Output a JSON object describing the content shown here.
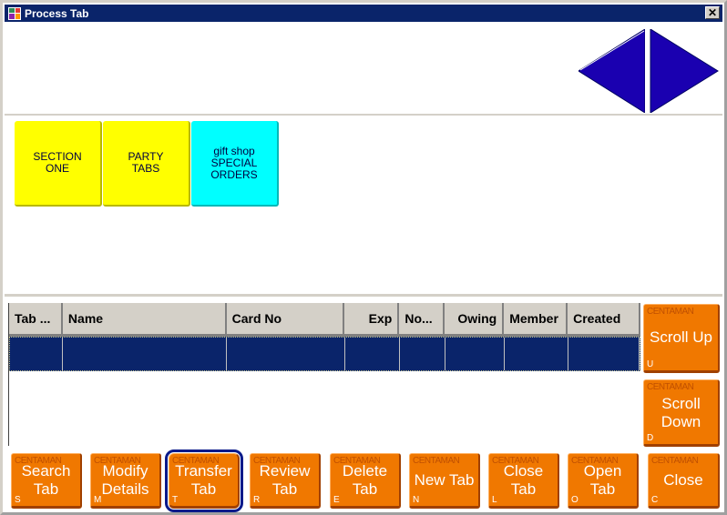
{
  "window": {
    "title": "Process Tab",
    "close_label": "✕"
  },
  "navigation": {
    "prev_icon": "triangle-left-icon",
    "next_icon": "triangle-right-icon",
    "arrow_color": "#1a00b0"
  },
  "sections": [
    {
      "label": "SECTION\nONE",
      "color": "#ffff00"
    },
    {
      "label": "PARTY\nTABS",
      "color": "#ffff00"
    },
    {
      "label": "gift shop\nSPECIAL\nORDERS",
      "color": "#00ffff"
    }
  ],
  "grid": {
    "columns": [
      "Tab ...",
      "Name",
      "Card No",
      "Exp",
      "No...",
      "Owing",
      "Member",
      "Created"
    ],
    "rows": [
      [
        "",
        "",
        "",
        "",
        "",
        "",
        "",
        ""
      ]
    ],
    "selected_row": 0
  },
  "side_buttons": [
    {
      "brand": "CENTAMAN",
      "label": "Scroll Up",
      "hotkey": "U"
    },
    {
      "brand": "CENTAMAN",
      "label": "Scroll\nDown",
      "hotkey": "D"
    }
  ],
  "bottom_buttons": [
    {
      "brand": "CENTAMAN",
      "label": "Search\nTab",
      "hotkey": "S"
    },
    {
      "brand": "CENTAMAN",
      "label": "Modify\nDetails",
      "hotkey": "M"
    },
    {
      "brand": "CENTAMAN",
      "label": "Transfer\nTab",
      "hotkey": "T",
      "selected": true
    },
    {
      "brand": "CENTAMAN",
      "label": "Review\nTab",
      "hotkey": "R"
    },
    {
      "brand": "CENTAMAN",
      "label": "Delete\nTab",
      "hotkey": "E"
    },
    {
      "brand": "CENTAMAN",
      "label": "New Tab",
      "hotkey": "N"
    },
    {
      "brand": "CENTAMAN",
      "label": "Close\nTab",
      "hotkey": "L"
    },
    {
      "brand": "CENTAMAN",
      "label": "Open\nTab",
      "hotkey": "O"
    },
    {
      "brand": "CENTAMAN",
      "label": "Close",
      "hotkey": "C"
    }
  ],
  "colors": {
    "titlebar": "#0a246a",
    "button_orange": "#f07800",
    "selection": "#0a246a"
  }
}
